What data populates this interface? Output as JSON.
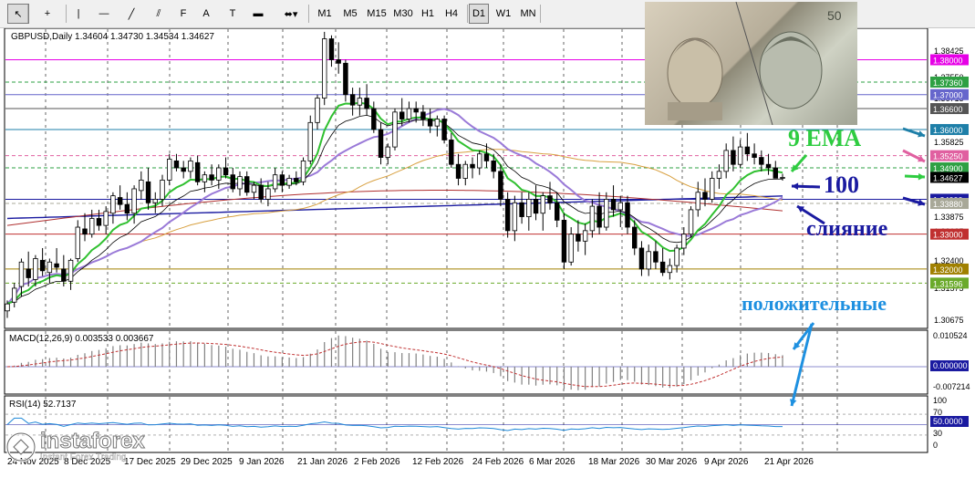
{
  "toolbar": {
    "tools": [
      {
        "name": "cursor-icon",
        "glyph": "↖"
      },
      {
        "name": "crosshair-icon",
        "glyph": "+"
      },
      {
        "name": "vertical-line-icon",
        "glyph": "|"
      },
      {
        "name": "horizontal-line-icon",
        "glyph": "—"
      },
      {
        "name": "trendline-icon",
        "glyph": "╱"
      },
      {
        "name": "equidistant-channel-icon",
        "glyph": "⫽"
      },
      {
        "name": "fibonacci-icon",
        "glyph": "F"
      },
      {
        "name": "text-icon",
        "glyph": "A"
      },
      {
        "name": "text-label-icon",
        "glyph": "T"
      },
      {
        "name": "rectangle-icon",
        "glyph": "▬"
      },
      {
        "name": "arrows-dropdown-icon",
        "glyph": "⬌▾"
      }
    ],
    "timeframes": [
      "M1",
      "M5",
      "M15",
      "M30",
      "H1",
      "H4",
      "D1",
      "W1",
      "MN"
    ],
    "active_timeframe": "D1"
  },
  "symbol_info": "GBPUSD,Daily  1.34604 1.34730 1.34534 1.34627",
  "price_axis": {
    "ticks": [
      "1.38425",
      "1.37550",
      "1.36715",
      "1.35825",
      "1.34875",
      "1.33875",
      "1.33125",
      "1.32400",
      "1.31575",
      "1.30675"
    ],
    "level_labels": [
      {
        "text": "1.38000",
        "price": 1.38,
        "bg": "#e600e6"
      },
      {
        "text": "1.37360",
        "price": 1.3736,
        "bg": "#2ea043"
      },
      {
        "text": "1.37000",
        "price": 1.37,
        "bg": "#6666cc"
      },
      {
        "text": "1.36600",
        "price": 1.366,
        "bg": "#555555"
      },
      {
        "text": "1.36000",
        "price": 1.36,
        "bg": "#1e7fa8"
      },
      {
        "text": "1.35250",
        "price": 1.3525,
        "bg": "#e060a0"
      },
      {
        "text": "1.34900",
        "price": 1.349,
        "bg": "#2ea043"
      },
      {
        "text": "1.34627",
        "price": 1.34627,
        "bg": "#000000"
      },
      {
        "text": "1.34000",
        "price": 1.34,
        "bg": "#1a1aa0"
      },
      {
        "text": "1.33880",
        "price": 1.3388,
        "bg": "#a8a898"
      },
      {
        "text": "1.33000",
        "price": 1.33,
        "bg": "#c03030"
      },
      {
        "text": "1.32000",
        "price": 1.32,
        "bg": "#a08000"
      },
      {
        "text": "1.31596",
        "price": 1.31596,
        "bg": "#6aaa2a"
      }
    ]
  },
  "date_axis": {
    "labels": [
      "24 Nov 2025",
      "8 Dec 2025",
      "17 Dec 2025",
      "29 Dec 2025",
      "9 Jan 2026",
      "21 Jan 2026",
      "2 Feb 2026",
      "12 Feb 2026",
      "24 Feb 2026",
      "6 Mar 2026",
      "18 Mar 2026",
      "30 Mar 2026",
      "9 Apr 2026",
      "21 Apr 2026"
    ]
  },
  "macd": {
    "label": "MACD(12,26,9) 0.003533 0.003667",
    "ticks": [
      "0.010524",
      "0.000000",
      "-0.007214"
    ]
  },
  "rsi": {
    "label": "RSI(14) 52.7137",
    "ticks": [
      "100",
      "70",
      "50.0000",
      "30",
      "0"
    ]
  },
  "annotations": {
    "ema": "9 EMA",
    "hundred": "100",
    "merge": "слияние",
    "positive": "положительные"
  },
  "brand": {
    "name": "instaforex",
    "tagline": "Instant Forex Trading"
  },
  "chart_data": {
    "type": "candlestick",
    "symbol": "GBPUSD",
    "timeframe": "Daily",
    "ohlc_last": {
      "open": 1.34604,
      "high": 1.3473,
      "low": 1.34534,
      "close": 1.34627
    },
    "ylim": [
      1.3035,
      1.3885
    ],
    "candles": [
      [
        1.308,
        1.311,
        1.306,
        1.31
      ],
      [
        1.3105,
        1.316,
        1.309,
        1.3145
      ],
      [
        1.315,
        1.323,
        1.312,
        1.322
      ],
      [
        1.32,
        1.325,
        1.315,
        1.3175
      ],
      [
        1.317,
        1.324,
        1.315,
        1.323
      ],
      [
        1.3225,
        1.326,
        1.318,
        1.3195
      ],
      [
        1.319,
        1.323,
        1.316,
        1.322
      ],
      [
        1.3215,
        1.326,
        1.319,
        1.3205
      ],
      [
        1.32,
        1.324,
        1.315,
        1.3165
      ],
      [
        1.3165,
        1.323,
        1.314,
        1.3225
      ],
      [
        1.323,
        1.334,
        1.322,
        1.332
      ],
      [
        1.3315,
        1.336,
        1.328,
        1.33
      ],
      [
        1.33,
        1.337,
        1.329,
        1.3345
      ],
      [
        1.3345,
        1.337,
        1.331,
        1.3325
      ],
      [
        1.3325,
        1.338,
        1.33,
        1.3365
      ],
      [
        1.336,
        1.342,
        1.333,
        1.341
      ],
      [
        1.3405,
        1.344,
        1.337,
        1.3385
      ],
      [
        1.3385,
        1.342,
        1.334,
        1.336
      ],
      [
        1.336,
        1.344,
        1.333,
        1.343
      ],
      [
        1.3425,
        1.348,
        1.34,
        1.3455
      ],
      [
        1.345,
        1.349,
        1.337,
        1.339
      ],
      [
        1.339,
        1.342,
        1.336,
        1.34
      ],
      [
        1.34,
        1.347,
        1.338,
        1.3455
      ],
      [
        1.3455,
        1.353,
        1.344,
        1.3515
      ],
      [
        1.351,
        1.353,
        1.348,
        1.349
      ],
      [
        1.349,
        1.351,
        1.346,
        1.348
      ],
      [
        1.348,
        1.352,
        1.346,
        1.351
      ],
      [
        1.3505,
        1.3525,
        1.344,
        1.345
      ],
      [
        1.345,
        1.348,
        1.342,
        1.347
      ],
      [
        1.347,
        1.35,
        1.344,
        1.3455
      ],
      [
        1.3455,
        1.35,
        1.343,
        1.349
      ],
      [
        1.349,
        1.352,
        1.346,
        1.347
      ],
      [
        1.347,
        1.349,
        1.342,
        1.343
      ],
      [
        1.343,
        1.348,
        1.341,
        1.3465
      ],
      [
        1.3465,
        1.348,
        1.341,
        1.342
      ],
      [
        1.342,
        1.345,
        1.34,
        1.344
      ],
      [
        1.344,
        1.346,
        1.339,
        1.34
      ],
      [
        1.34,
        1.345,
        1.338,
        1.343
      ],
      [
        1.343,
        1.349,
        1.342,
        1.347
      ],
      [
        1.347,
        1.348,
        1.342,
        1.344
      ],
      [
        1.344,
        1.347,
        1.343,
        1.346
      ],
      [
        1.346,
        1.348,
        1.344,
        1.345
      ],
      [
        1.345,
        1.352,
        1.344,
        1.351
      ],
      [
        1.351,
        1.364,
        1.35,
        1.362
      ],
      [
        1.362,
        1.37,
        1.36,
        1.369
      ],
      [
        1.369,
        1.388,
        1.367,
        1.386
      ],
      [
        1.386,
        1.387,
        1.378,
        1.38
      ],
      [
        1.38,
        1.385,
        1.376,
        1.379
      ],
      [
        1.379,
        1.38,
        1.368,
        1.37
      ],
      [
        1.37,
        1.372,
        1.364,
        1.367
      ],
      [
        1.367,
        1.372,
        1.364,
        1.369
      ],
      [
        1.369,
        1.373,
        1.364,
        1.366
      ],
      [
        1.366,
        1.368,
        1.359,
        1.36
      ],
      [
        1.36,
        1.362,
        1.35,
        1.352
      ],
      [
        1.352,
        1.356,
        1.35,
        1.355
      ],
      [
        1.355,
        1.366,
        1.354,
        1.365
      ],
      [
        1.365,
        1.369,
        1.361,
        1.363
      ],
      [
        1.363,
        1.368,
        1.362,
        1.366
      ],
      [
        1.366,
        1.368,
        1.362,
        1.365
      ],
      [
        1.365,
        1.367,
        1.361,
        1.363
      ],
      [
        1.363,
        1.366,
        1.359,
        1.361
      ],
      [
        1.361,
        1.364,
        1.358,
        1.363
      ],
      [
        1.363,
        1.364,
        1.356,
        1.357
      ],
      [
        1.357,
        1.359,
        1.349,
        1.35
      ],
      [
        1.35,
        1.353,
        1.344,
        1.346
      ],
      [
        1.346,
        1.351,
        1.344,
        1.35
      ],
      [
        1.35,
        1.352,
        1.346,
        1.349
      ],
      [
        1.349,
        1.354,
        1.347,
        1.353
      ],
      [
        1.353,
        1.356,
        1.349,
        1.351
      ],
      [
        1.351,
        1.353,
        1.346,
        1.348
      ],
      [
        1.348,
        1.35,
        1.338,
        1.34
      ],
      [
        1.34,
        1.342,
        1.329,
        1.331
      ],
      [
        1.331,
        1.341,
        1.328,
        1.339
      ],
      [
        1.339,
        1.342,
        1.333,
        1.335
      ],
      [
        1.335,
        1.342,
        1.331,
        1.34
      ],
      [
        1.34,
        1.344,
        1.334,
        1.336
      ],
      [
        1.336,
        1.342,
        1.331,
        1.341
      ],
      [
        1.341,
        1.345,
        1.337,
        1.339
      ],
      [
        1.339,
        1.342,
        1.332,
        1.334
      ],
      [
        1.334,
        1.336,
        1.32,
        1.322
      ],
      [
        1.322,
        1.332,
        1.321,
        1.33
      ],
      [
        1.33,
        1.334,
        1.325,
        1.328
      ],
      [
        1.328,
        1.333,
        1.324,
        1.331
      ],
      [
        1.331,
        1.34,
        1.329,
        1.338
      ],
      [
        1.338,
        1.342,
        1.33,
        1.332
      ],
      [
        1.332,
        1.342,
        1.331,
        1.34
      ],
      [
        1.34,
        1.344,
        1.335,
        1.337
      ],
      [
        1.337,
        1.341,
        1.332,
        1.339
      ],
      [
        1.339,
        1.341,
        1.33,
        1.332
      ],
      [
        1.332,
        1.334,
        1.324,
        1.326
      ],
      [
        1.326,
        1.328,
        1.318,
        1.32
      ],
      [
        1.32,
        1.327,
        1.318,
        1.325
      ],
      [
        1.325,
        1.328,
        1.32,
        1.322
      ],
      [
        1.322,
        1.326,
        1.318,
        1.319
      ],
      [
        1.319,
        1.323,
        1.317,
        1.321
      ],
      [
        1.321,
        1.327,
        1.319,
        1.326
      ],
      [
        1.326,
        1.332,
        1.324,
        1.33
      ],
      [
        1.33,
        1.338,
        1.329,
        1.337
      ],
      [
        1.337,
        1.345,
        1.335,
        1.342
      ],
      [
        1.342,
        1.346,
        1.338,
        1.34
      ],
      [
        1.34,
        1.348,
        1.339,
        1.346
      ],
      [
        1.346,
        1.35,
        1.343,
        1.348
      ],
      [
        1.348,
        1.356,
        1.346,
        1.354
      ],
      [
        1.354,
        1.358,
        1.348,
        1.35
      ],
      [
        1.35,
        1.357,
        1.349,
        1.355
      ],
      [
        1.355,
        1.359,
        1.351,
        1.353
      ],
      [
        1.353,
        1.356,
        1.35,
        1.352
      ],
      [
        1.352,
        1.354,
        1.348,
        1.35
      ],
      [
        1.35,
        1.353,
        1.347,
        1.349
      ],
      [
        1.349,
        1.351,
        1.346,
        1.34604
      ],
      [
        1.34604,
        1.3473,
        1.34534,
        1.34627
      ]
    ]
  }
}
